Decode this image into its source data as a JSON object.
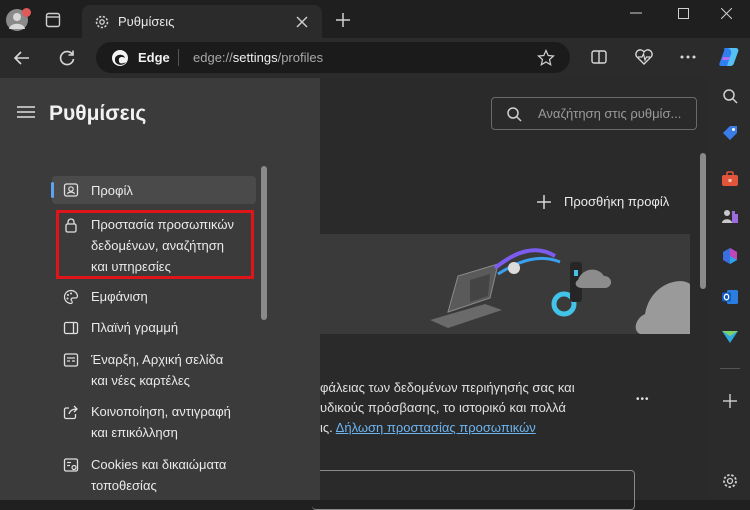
{
  "browser": {
    "tab_title": "Ρυθμίσεις",
    "address_brand": "Edge",
    "url_prefix": "edge://",
    "url_host": "settings",
    "url_path": "/profiles"
  },
  "settings": {
    "title": "Ρυθμίσεις",
    "search_placeholder": "Αναζήτηση στις ρυθμίσ...",
    "nav": [
      {
        "label": "Προφίλ",
        "icon": "profile-icon"
      },
      {
        "label": "Προστασία προσωπικών\nδεδομένων, αναζήτηση\nκαι υπηρεσίες",
        "icon": "lock-icon"
      },
      {
        "label": "Εμφάνιση",
        "icon": "palette-icon"
      },
      {
        "label": "Πλαϊνή γραμμή",
        "icon": "sidebar-icon"
      },
      {
        "label": "Έναρξη, Αρχική σελίδα\nκαι νέες καρτέλες",
        "icon": "home-tabs-icon"
      },
      {
        "label": "Κοινοποίηση, αντιγραφή\nκαι επικόλληση",
        "icon": "share-icon"
      },
      {
        "label": "Cookies και δικαιώματα\nτοποθεσίας",
        "icon": "cookies-icon"
      }
    ]
  },
  "main": {
    "add_profile": "Προσθήκη προφίλ",
    "text_line1": "φάλειας των δεδομένων περιήγησής σας και",
    "text_line2": "υδικούς πρόσβασης, το ιστορικό και πολλά",
    "text_line3_prefix": "ις. ",
    "privacy_link": "Δήλωση προστασίας προσωπικών",
    "more": "•••"
  },
  "colors": {
    "accent": "#5ea4ef",
    "highlight_border": "#e0151a"
  }
}
